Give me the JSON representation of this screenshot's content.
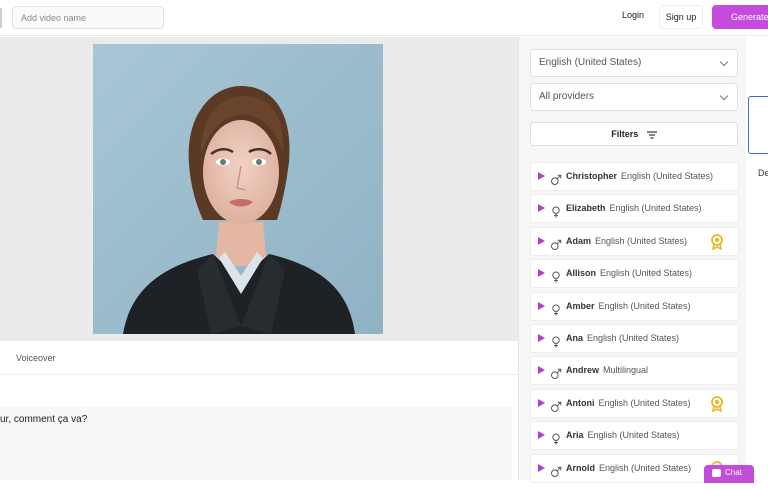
{
  "header": {
    "video_name_placeholder": "Add video name",
    "login_label": "Login",
    "signup_label": "Sign up",
    "generate_label": "Generate"
  },
  "editor": {
    "voiceover_tab": "Voiceover",
    "script_text": "ur, comment ça va?"
  },
  "voice_panel": {
    "language_select": "English (United States)",
    "provider_select": "All providers",
    "filters_label": "Filters",
    "voices": [
      {
        "name": "Christopher",
        "language": "English (United States)",
        "gender": "male",
        "premium": false
      },
      {
        "name": "Elizabeth",
        "language": "English (United States)",
        "gender": "female",
        "premium": false
      },
      {
        "name": "Adam",
        "language": "English (United States)",
        "gender": "male",
        "premium": true
      },
      {
        "name": "Allison",
        "language": "English (United States)",
        "gender": "female",
        "premium": false
      },
      {
        "name": "Amber",
        "language": "English (United States)",
        "gender": "female",
        "premium": false
      },
      {
        "name": "Ana",
        "language": "English (United States)",
        "gender": "female",
        "premium": false
      },
      {
        "name": "Andrew",
        "language": "Multilingual",
        "gender": "male",
        "premium": false
      },
      {
        "name": "Antoni",
        "language": "English (United States)",
        "gender": "male",
        "premium": true
      },
      {
        "name": "Aria",
        "language": "English (United States)",
        "gender": "female",
        "premium": false
      },
      {
        "name": "Arnold",
        "language": "English (United States)",
        "gender": "male",
        "premium": true
      }
    ]
  },
  "right_strip": {
    "label_fragment": "De"
  },
  "chat": {
    "label": "Chat"
  },
  "colors": {
    "accent": "#c44bdc",
    "play": "#b23fd3",
    "premium_badge": "#e8b923",
    "selection_border": "#2f6fd6"
  }
}
